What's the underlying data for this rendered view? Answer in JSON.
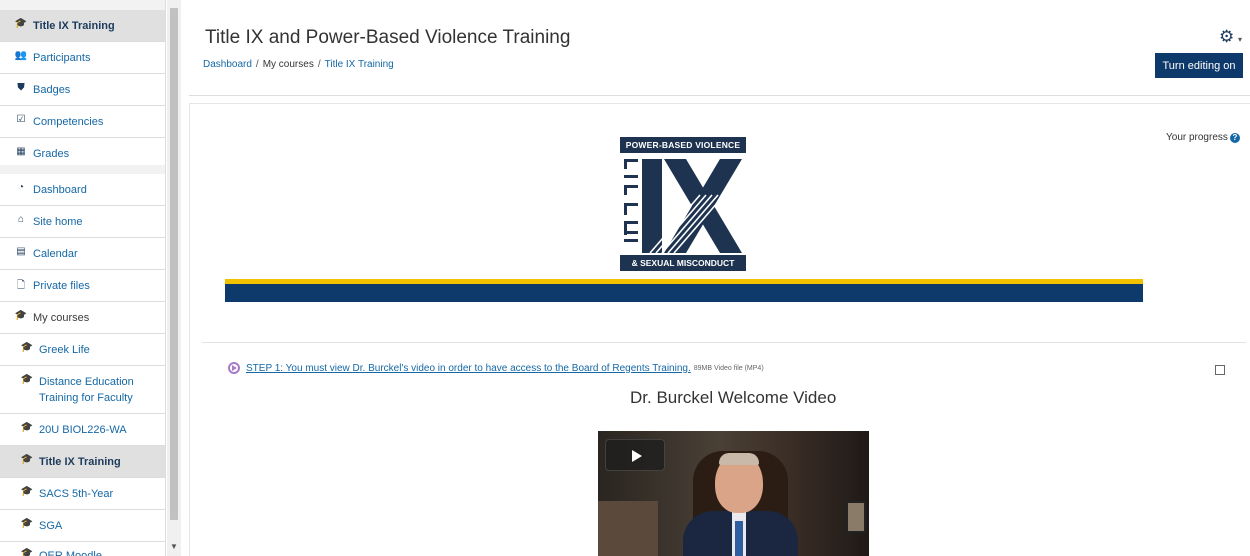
{
  "sidebar": {
    "items": [
      {
        "label": "Title IX Training",
        "icon": "graduation-cap-icon",
        "glyph": "🎓",
        "active": true
      },
      {
        "label": "Participants",
        "icon": "users-icon",
        "glyph": "👥"
      },
      {
        "label": "Badges",
        "icon": "shield-icon",
        "glyph": "⛊"
      },
      {
        "label": "Competencies",
        "icon": "checkbox-icon",
        "glyph": "☑"
      },
      {
        "label": "Grades",
        "icon": "table-icon",
        "glyph": "▦"
      },
      {
        "label": "Dashboard",
        "icon": "tachometer-icon",
        "glyph": "◔"
      },
      {
        "label": "Site home",
        "icon": "home-icon",
        "glyph": "⌂"
      },
      {
        "label": "Calendar",
        "icon": "calendar-icon",
        "glyph": "▤"
      },
      {
        "label": "Private files",
        "icon": "file-icon",
        "glyph": "🗋"
      },
      {
        "label": "My courses",
        "icon": "graduation-cap-icon",
        "glyph": "🎓"
      },
      {
        "label": "Greek Life",
        "icon": "graduation-cap-icon",
        "glyph": "🎓"
      },
      {
        "label": "Distance Education Training for Faculty",
        "icon": "graduation-cap-icon",
        "glyph": "🎓"
      },
      {
        "label": "20U BIOL226-WA",
        "icon": "graduation-cap-icon",
        "glyph": "🎓"
      },
      {
        "label": "Title IX Training",
        "icon": "graduation-cap-icon",
        "glyph": "🎓",
        "active": true
      },
      {
        "label": "SACS 5th-Year",
        "icon": "graduation-cap-icon",
        "glyph": "🎓"
      },
      {
        "label": "SGA",
        "icon": "graduation-cap-icon",
        "glyph": "🎓"
      },
      {
        "label": "OER Moodle",
        "icon": "graduation-cap-icon",
        "glyph": "🎓"
      }
    ]
  },
  "header": {
    "title": "Title IX and Power-Based Violence Training",
    "breadcrumb": [
      "Dashboard",
      "My courses",
      "Title IX Training"
    ],
    "edit_button": "Turn editing on",
    "gear_icon": "gear-icon"
  },
  "progress_label": "Your progress",
  "logo": {
    "top_text": "POWER-BASED VIOLENCE",
    "side_text": "TITLE",
    "main_text": "IX",
    "bottom_text": "& SEXUAL MISCONDUCT"
  },
  "colors": {
    "navy": "#0e3a6b",
    "gold": "#f2c200",
    "link": "#1568a6",
    "logo_dark": "#1e3350"
  },
  "activity": {
    "link_text": "STEP 1: You must view Dr. Burckel's video in order to have access to the Board of Regents Training.",
    "meta": "89MB Video file (MP4)",
    "icon": "video-file-icon"
  },
  "video_title": "Dr. Burckel Welcome Video"
}
